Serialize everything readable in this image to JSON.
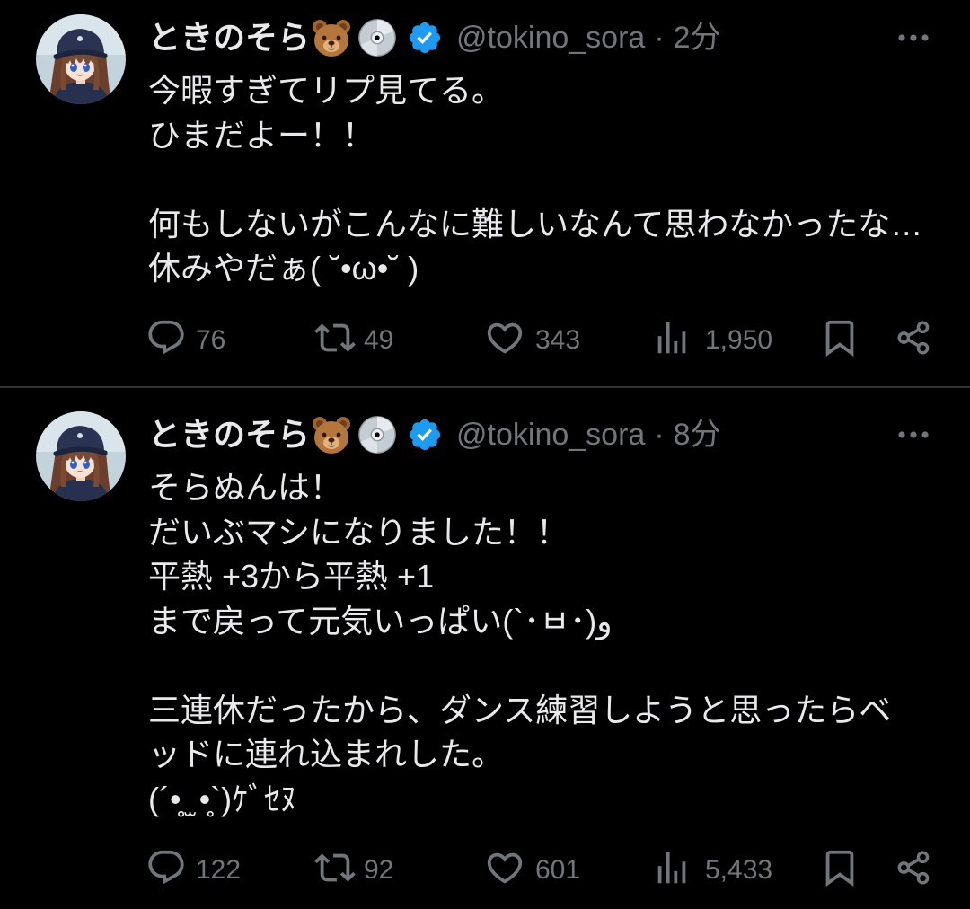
{
  "theme": "dark",
  "colors": {
    "background": "#000000",
    "text": "#e7e9ea",
    "secondary": "#71767b",
    "verified": "#1d9bf0",
    "divider": "#2f3336"
  },
  "tweets": [
    {
      "author": {
        "name": "ときのそら",
        "name_emoji_icons": [
          "bear-face-emoji",
          "optical-disc-emoji"
        ],
        "verified": true,
        "handle": "@tokino_sora",
        "separator": "·",
        "time": "2分"
      },
      "text_lines": [
        "今暇すぎてリプ見てる。",
        "ひまだよー！！",
        "",
        "何もしないがこんなに難しいなんて思わなかったな…",
        "休みやだぁ( ˘•ω•˘ )"
      ],
      "stats": {
        "replies": "76",
        "reposts": "49",
        "likes": "343",
        "views": "1,950"
      }
    },
    {
      "author": {
        "name": "ときのそら",
        "name_emoji_icons": [
          "bear-face-emoji",
          "optical-disc-emoji"
        ],
        "verified": true,
        "handle": "@tokino_sora",
        "separator": "·",
        "time": "8分"
      },
      "text_lines": [
        "そらぬんは！",
        "だいぶマシになりました！！",
        "平熱 +3から平熱 +1",
        "まで戻って元気いっぱい(`･ㅂ･)و",
        "",
        "三連休だったから、ダンス練習しようと思ったらベ",
        "ッドに連れ込まれした。",
        "(´•̥ ̫ •̥`)ｹﾞｾﾇ"
      ],
      "stats": {
        "replies": "122",
        "reposts": "92",
        "likes": "601",
        "views": "5,433"
      }
    }
  ]
}
